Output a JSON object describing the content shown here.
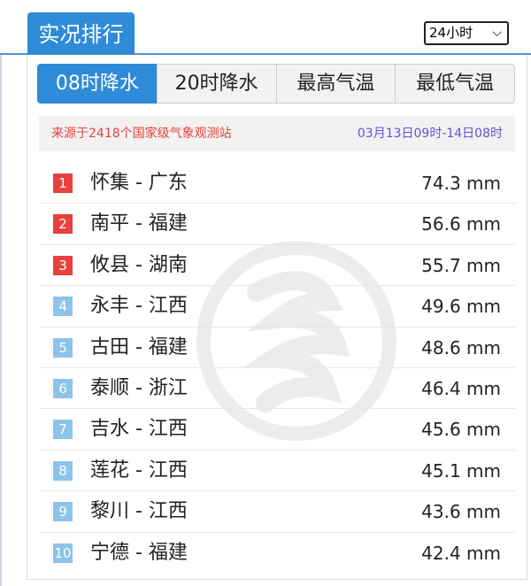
{
  "header": {
    "title": "实况排行"
  },
  "period_select": {
    "value": "24小时"
  },
  "tabs": [
    {
      "label": "08时降水",
      "active": true
    },
    {
      "label": "20时降水",
      "active": false
    },
    {
      "label": "最高气温",
      "active": false
    },
    {
      "label": "最低气温",
      "active": false
    }
  ],
  "source": {
    "left": "来源于2418个国家级气象观测站",
    "right": "03月13日09时-14日08时"
  },
  "colors": {
    "accent": "#2e8bd8",
    "top_rank": "#e8403c",
    "other_rank": "#8ec3ea",
    "source_left": "#e8403c",
    "source_right": "#6a4fd3"
  },
  "rows": [
    {
      "rank": "1",
      "name": "怀集 - 广东",
      "value": "74.3 mm"
    },
    {
      "rank": "2",
      "name": "南平 - 福建",
      "value": "56.6 mm"
    },
    {
      "rank": "3",
      "name": "攸县 - 湖南",
      "value": "55.7 mm"
    },
    {
      "rank": "4",
      "name": "永丰 - 江西",
      "value": "49.6 mm"
    },
    {
      "rank": "5",
      "name": "古田 - 福建",
      "value": "48.6 mm"
    },
    {
      "rank": "6",
      "name": "泰顺 - 浙江",
      "value": "46.4 mm"
    },
    {
      "rank": "7",
      "name": "吉水 - 江西",
      "value": "45.6 mm"
    },
    {
      "rank": "8",
      "name": "莲花 - 江西",
      "value": "45.1 mm"
    },
    {
      "rank": "9",
      "name": "黎川 - 江西",
      "value": "43.6 mm"
    },
    {
      "rank": "10",
      "name": "宁德 - 福建",
      "value": "42.4 mm"
    }
  ]
}
